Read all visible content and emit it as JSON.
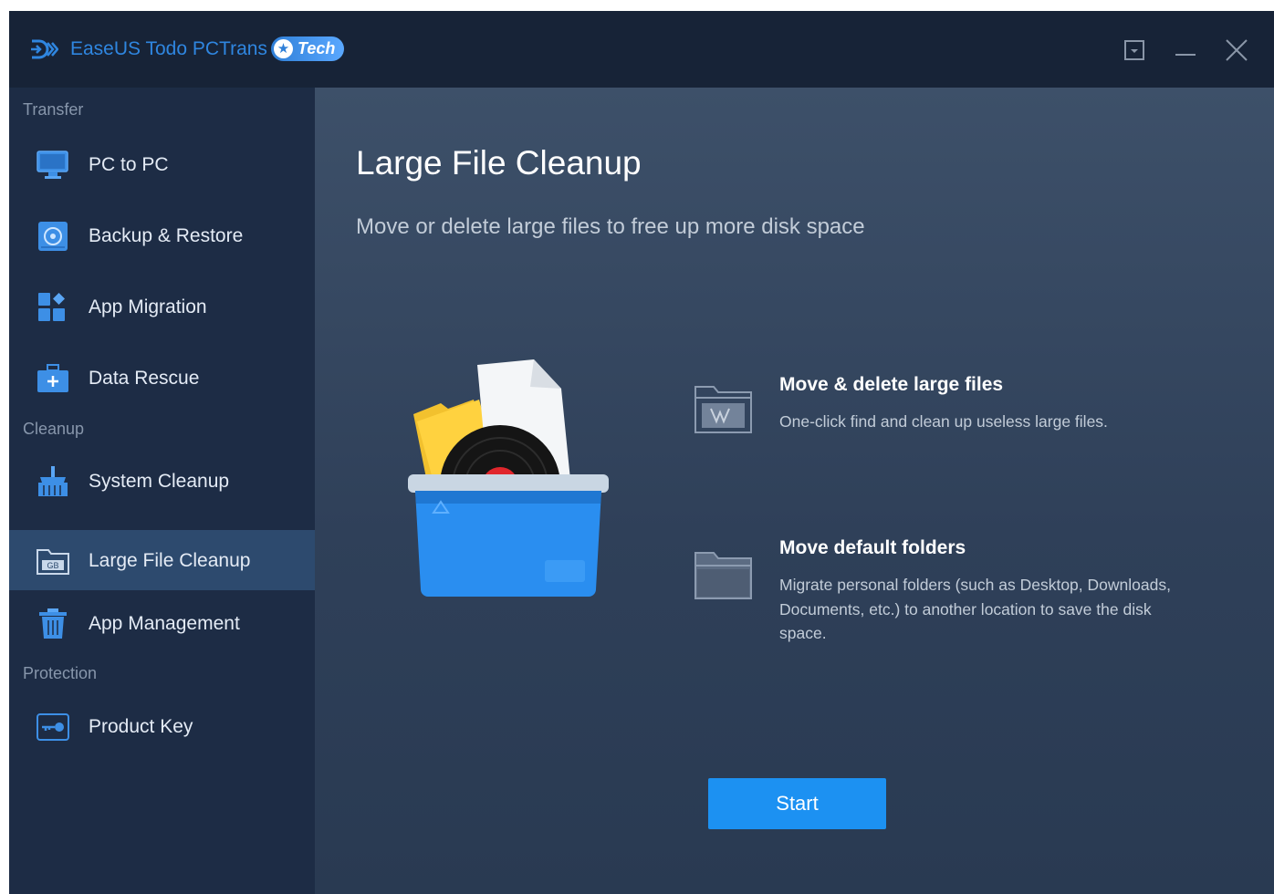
{
  "titlebar": {
    "app_name": "EaseUS Todo PCTrans",
    "edition_badge": "Tech",
    "logo_icon": "transfer-arrow-logo",
    "buttons": [
      "dropdown-menu-icon",
      "minimize-icon",
      "close-icon"
    ]
  },
  "sidebar": {
    "sections": [
      {
        "title": "Transfer"
      },
      {
        "title": "Cleanup"
      },
      {
        "title": "Protection"
      }
    ],
    "items": [
      {
        "label": "PC to PC",
        "icon": "monitor-icon"
      },
      {
        "label": "Backup & Restore",
        "icon": "backup-icon"
      },
      {
        "label": "App Migration",
        "icon": "app-grid-icon"
      },
      {
        "label": "Data Rescue",
        "icon": "rescue-kit-icon"
      },
      {
        "label": "System Cleanup",
        "icon": "broom-icon"
      },
      {
        "label": "Large File Cleanup",
        "icon": "gb-folder-icon",
        "active": true
      },
      {
        "label": "App Management",
        "icon": "trash-bin-icon"
      },
      {
        "label": "Product Key",
        "icon": "key-icon"
      }
    ]
  },
  "main": {
    "title": "Large File Cleanup",
    "subtitle": "Move or delete large files to free up more disk space",
    "features": [
      {
        "title": "Move & delete large files",
        "description": "One-click find and clean up useless large files.",
        "icon": "large-file-folder-icon"
      },
      {
        "title": "Move default folders",
        "description": "Migrate personal folders (such as Desktop, Downloads, Documents, etc.) to another location to save the disk space.",
        "icon": "open-folder-icon"
      }
    ],
    "start_button": "Start"
  },
  "colors": {
    "accent": "#1c91f2",
    "titlebar_bg": "#172337",
    "sidebar_bg": "#1d2c45",
    "sidebar_active_bg": "#2d4a6e",
    "main_bg": "#3a4d66",
    "brand_text": "#2f86e0"
  }
}
